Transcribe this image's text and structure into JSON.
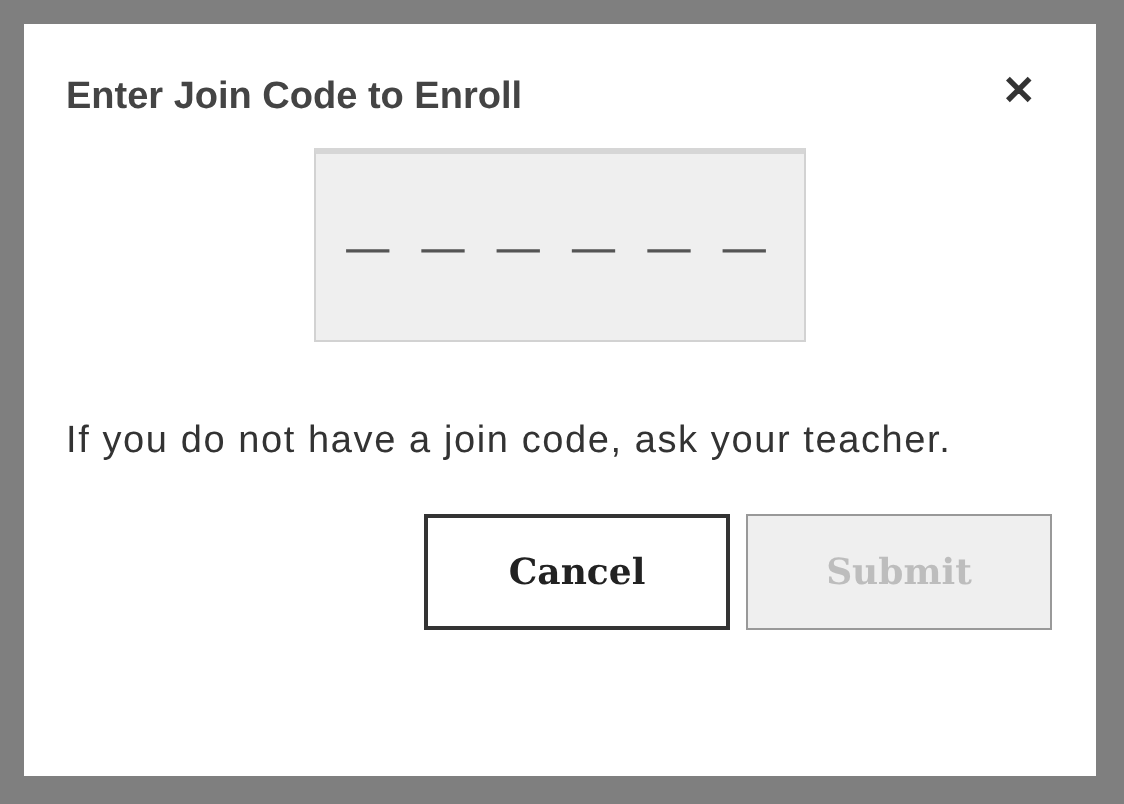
{
  "dialog": {
    "title": "Enter Join Code to Enroll",
    "close": "✕"
  },
  "code_field": {
    "placeholder": "— — — — — —"
  },
  "message": "If you do not have a join code, ask your teacher.",
  "buttons": [
    {
      "label": "Cancel",
      "disabled": false
    },
    {
      "label": "Submit",
      "disabled": true
    }
  ]
}
